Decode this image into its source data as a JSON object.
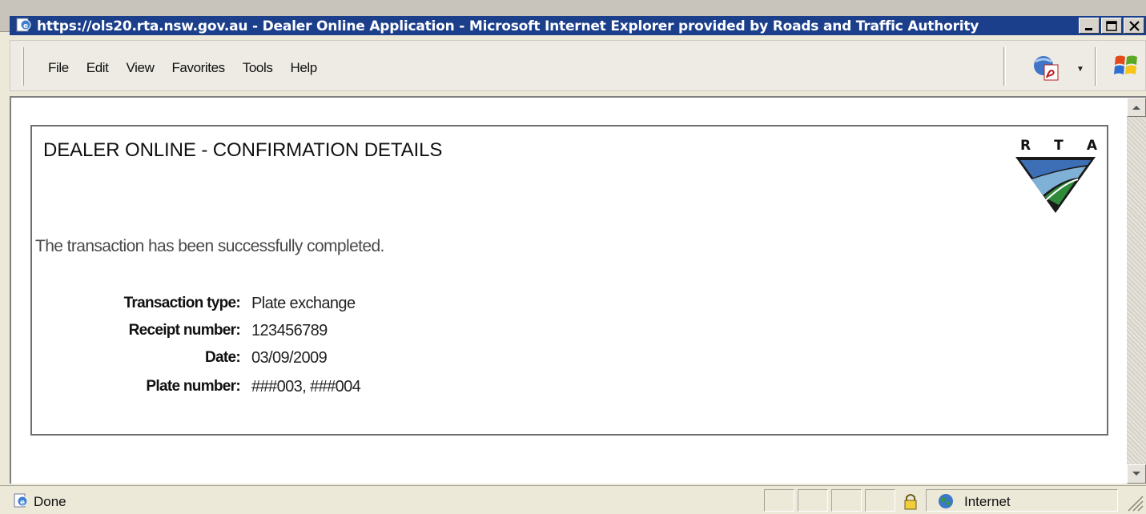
{
  "window": {
    "title": "https://ols20.rta.nsw.gov.au - Dealer Online Application - Microsoft Internet Explorer provided by Roads and Traffic Authority",
    "title_bar_color": "#1c3f8c"
  },
  "menu": {
    "items": [
      {
        "label": "File"
      },
      {
        "label": "Edit"
      },
      {
        "label": "View"
      },
      {
        "label": "Favorites"
      },
      {
        "label": "Tools"
      },
      {
        "label": "Help"
      }
    ]
  },
  "toolbar": {
    "icons": [
      "pdf-icon",
      "dropdown-arrow-icon",
      "windows-logo-icon"
    ]
  },
  "page": {
    "heading": "DEALER ONLINE - CONFIRMATION DETAILS",
    "logo": {
      "letters": [
        "R",
        "T",
        "A"
      ]
    },
    "message": "The transaction has been successfully completed.",
    "details": [
      {
        "label": "Transaction type:",
        "value": "Plate exchange"
      },
      {
        "label": "Receipt number:",
        "value": "123456789"
      },
      {
        "label": "Date:",
        "value": "03/09/2009"
      },
      {
        "label": "Plate number:",
        "value": "###003, ###004"
      }
    ]
  },
  "status": {
    "text": "Done",
    "zone": "Internet"
  }
}
